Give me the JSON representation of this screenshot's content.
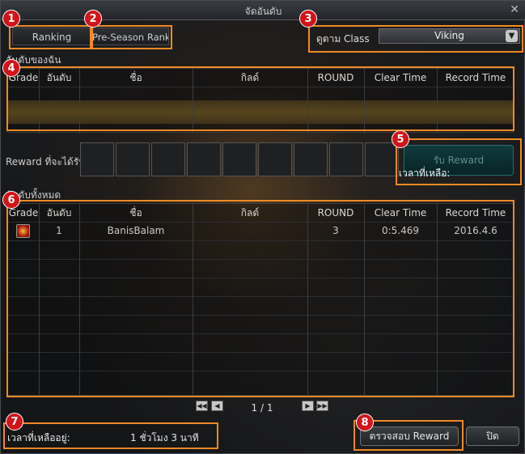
{
  "window": {
    "title": "จัดอันดับ",
    "close_glyph": "✕"
  },
  "tabs": [
    {
      "label": "Ranking"
    },
    {
      "label": "Pre-Season Ranking"
    }
  ],
  "class_filter": {
    "label": "ดูตาม Class",
    "selected": "Viking"
  },
  "my_ranking": {
    "section_title": "อันดับของฉัน",
    "columns": [
      "Grade",
      "อันดับ",
      "ชื่อ",
      "กิลด์",
      "ROUND",
      "Clear Time",
      "Record Time"
    ]
  },
  "reward": {
    "label": "Reward ที่จะได้รับ",
    "button_label": "รับ Reward",
    "time_left_label": "เวลาที่เหลือ:"
  },
  "all_ranking": {
    "section_title": "อันดับทั้งหมด",
    "columns": [
      "Grade",
      "อันดับ",
      "ชื่อ",
      "กิลด์",
      "ROUND",
      "Clear Time",
      "Record Time"
    ],
    "rows": [
      {
        "rank": "1",
        "name": "BanisBalam",
        "guild": "",
        "round": "3",
        "clear_time": "0:5.469",
        "record_time": "2016.4.6"
      }
    ]
  },
  "pagination": {
    "current": "1 / 1"
  },
  "footer": {
    "remaining_label": "เวลาที่เหลืออยู่:",
    "remaining_value": "1 ชั่วโมง 3 นาที",
    "check_reward_label": "ตรวจสอบ Reward",
    "close_label": "ปิด"
  },
  "annotations": [
    "1",
    "2",
    "3",
    "4",
    "5",
    "6",
    "7",
    "8"
  ],
  "colors": {
    "annotation": "#f08a24",
    "badge": "#d0141a"
  }
}
